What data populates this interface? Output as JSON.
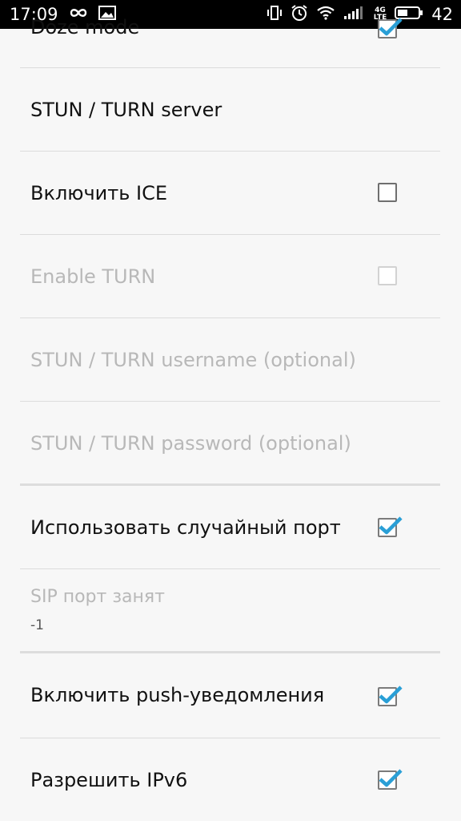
{
  "status_bar": {
    "time": "17:09",
    "network_label_top": "4G",
    "network_label_bottom": "LTE",
    "battery_level": "42",
    "icons": [
      "infinity-icon",
      "image-icon",
      "vibrate-icon",
      "alarm-icon",
      "wifi-icon",
      "signal-icon",
      "battery-icon"
    ]
  },
  "settings": {
    "doze_mode": {
      "label": "Doze mode",
      "checked": true
    },
    "stun_turn_server": {
      "label": "STUN / TURN server"
    },
    "enable_ice": {
      "label": "Включить ICE",
      "checked": false
    },
    "enable_turn": {
      "label": "Enable TURN",
      "checked": false,
      "enabled": false
    },
    "turn_username": {
      "label": "STUN / TURN username (optional)",
      "enabled": false
    },
    "turn_password": {
      "label": "STUN / TURN password (optional)",
      "enabled": false
    },
    "random_port": {
      "label": "Использовать случайный порт",
      "checked": true
    },
    "sip_port": {
      "label": "SIP порт занят",
      "value": "-1",
      "enabled": false
    },
    "push_notifications": {
      "label": "Включить push-уведомления",
      "checked": true
    },
    "allow_ipv6": {
      "label": "Разрешить IPv6",
      "checked": true
    }
  },
  "colors": {
    "check_accent": "#2a9fd6",
    "disabled_text": "#b8b8b8",
    "text": "#111111"
  }
}
